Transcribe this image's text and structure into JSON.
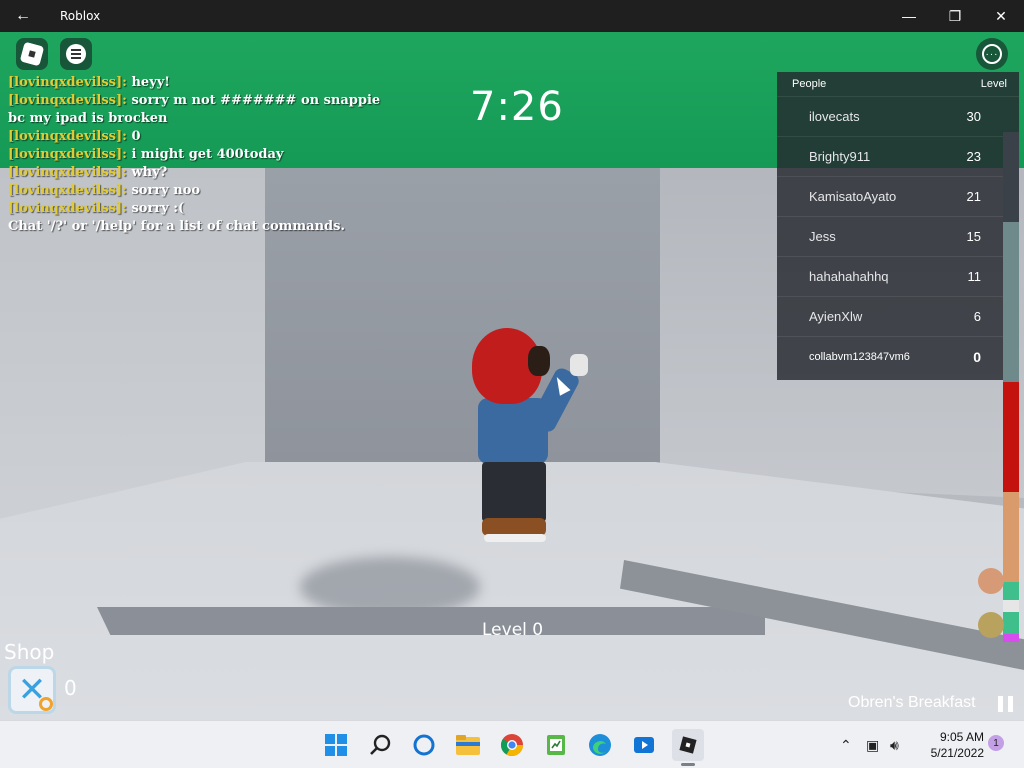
{
  "window": {
    "title": "Roblox",
    "back_glyph": "←",
    "minimize_glyph": "—",
    "maximize_glyph": "❐",
    "close_glyph": "✕"
  },
  "game": {
    "timer": "7:26",
    "level_label": "Level 0",
    "shop_label": "Shop",
    "shop_count": "0",
    "song": "Obren's Breakfast",
    "more_glyph": "···"
  },
  "chat": {
    "lines": [
      {
        "user": "[lovinqxdevilss]:",
        "text": "heyy!"
      },
      {
        "user": "[lovinqxdevilss]:",
        "text": "sorry m not ####### on snappie bc my ipad is brocken"
      },
      {
        "user": "[lovinqxdevilss]:",
        "text": "0"
      },
      {
        "user": "[lovinqxdevilss]:",
        "text": "i might get 400today"
      },
      {
        "user": "[lovinqxdevilss]:",
        "text": "why?"
      },
      {
        "user": "[lovinqxdevilss]:",
        "text": "sorry noo"
      },
      {
        "user": "[lovinqxdevilss]:",
        "text": "sorry :("
      }
    ],
    "system": "Chat '/?' or '/help' for a list of chat commands."
  },
  "leaderboard": {
    "col_people": "People",
    "col_level": "Level",
    "rows": [
      {
        "name": "ilovecats",
        "level": "30"
      },
      {
        "name": "Brighty911",
        "level": "23"
      },
      {
        "name": "KamisatoAyato",
        "level": "21"
      },
      {
        "name": "Jess",
        "level": "15"
      },
      {
        "name": "hahahahahhq",
        "level": "11"
      },
      {
        "name": "AyienXlw",
        "level": "6"
      },
      {
        "name": "collabvm123847vm6",
        "level": "0"
      }
    ]
  },
  "taskbar": {
    "clock_time": "9:05 AM",
    "clock_date": "5/21/2022",
    "notification_count": "1",
    "icons": [
      "windows-start-icon",
      "search-icon",
      "cortana-icon",
      "file-explorer-icon",
      "chrome-icon",
      "notepad-icon",
      "edge-icon",
      "media-player-icon",
      "roblox-icon"
    ]
  },
  "colors": {
    "green_band": "#149a55",
    "chat_username": "#e2cc35",
    "leaderboard_bg": "#24282e"
  }
}
